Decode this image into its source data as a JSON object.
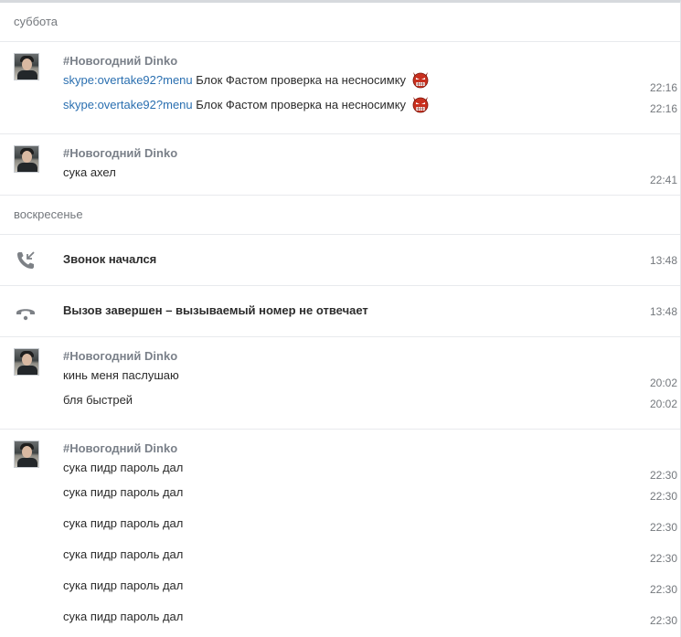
{
  "days": {
    "saturday": "суббота",
    "sunday": "воскресенье"
  },
  "sender_name": "#Новогодний Dinko",
  "group1": {
    "messages": [
      {
        "link": "skype:overtake92?menu",
        "text": " Блок Фастом проверка на несносимку",
        "emoji": "devil-emoji",
        "time": "22:16"
      },
      {
        "link": "skype:overtake92?menu",
        "text": " Блок Фастом проверка на несносимку",
        "emoji": "devil-emoji",
        "time": "22:16"
      }
    ]
  },
  "group2": {
    "messages": [
      {
        "text": "сука ахел",
        "time": "22:41"
      }
    ]
  },
  "calls": [
    {
      "icon": "incoming-call-icon",
      "text": "Звонок начался",
      "time": "13:48"
    },
    {
      "icon": "hangup-icon",
      "text": "Вызов завершен – вызываемый номер не отвечает",
      "time": "13:48"
    }
  ],
  "group3": {
    "messages": [
      {
        "text": "кинь меня паслушаю",
        "time": "20:02"
      },
      {
        "text": "бля быстрей",
        "time": "20:02"
      }
    ]
  },
  "group4": {
    "messages": [
      {
        "text": "сука пидр пароль дал",
        "time": "22:30"
      },
      {
        "text": "сука пидр пароль дал",
        "time": "22:30"
      },
      {
        "text": "сука пидр пароль дал",
        "time": "22:30"
      },
      {
        "text": "сука пидр пароль дал",
        "time": "22:30"
      },
      {
        "text": "сука пидр пароль дал",
        "time": "22:30"
      },
      {
        "text": "сука пидр пароль дал",
        "time": "22:30"
      }
    ]
  },
  "colors": {
    "link": "#2a6fb0",
    "sender": "#7a8089",
    "separator": "#e8eaed",
    "icon": "#7d8186"
  }
}
